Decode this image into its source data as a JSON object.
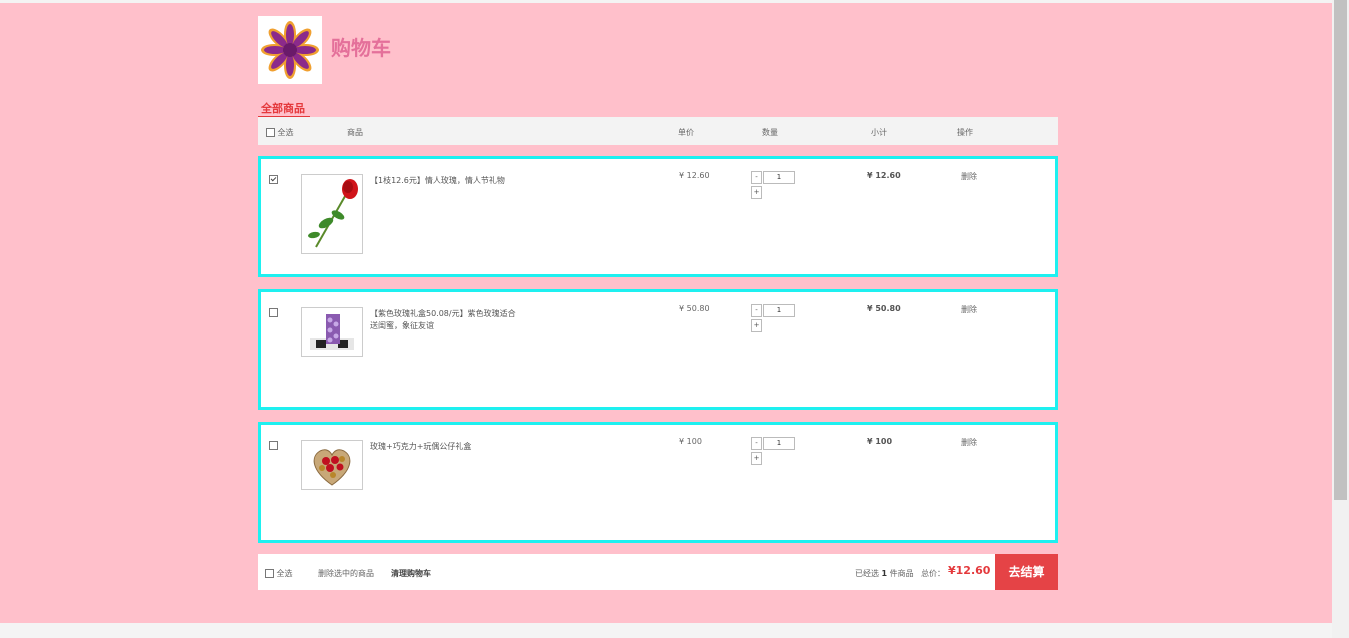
{
  "header": {
    "title": "购物车",
    "tab_all": "全部商品"
  },
  "table_header": {
    "select_all": "全选",
    "product": "商品",
    "unit_price": "单价",
    "quantity": "数量",
    "subtotal": "小计",
    "action": "操作"
  },
  "items": [
    {
      "checked": true,
      "name": "【1枝12.6元】情人玫瑰，情人节礼物",
      "price": "¥ 12.60",
      "minus": "-",
      "qty": "1",
      "plus": "+",
      "subtotal": "¥ 12.60",
      "delete": "删除"
    },
    {
      "checked": false,
      "name": "【紫色玫瑰礼盒50.08/元】紫色玫瑰适合送闺蜜，象征友谊",
      "price": "¥ 50.80",
      "minus": "-",
      "qty": "1",
      "plus": "+",
      "subtotal": "¥ 50.80",
      "delete": "删除"
    },
    {
      "checked": false,
      "name": "玫瑰+巧克力+玩偶公仔礼盒",
      "price": "¥ 100",
      "minus": "-",
      "qty": "1",
      "plus": "+",
      "subtotal": "¥ 100",
      "delete": "删除"
    }
  ],
  "footer": {
    "select_all": "全选",
    "delete_selected": "删除选中的商品",
    "clear_cart": "清理购物车",
    "selected_prefix": "已经选",
    "selected_count": "1",
    "selected_suffix": "件商品",
    "total_label": "总价：",
    "total_value": "¥12.60",
    "checkout": "去结算"
  },
  "colors": {
    "page_bg": "#ffc0cb",
    "item_border": "#1ef0f0",
    "accent_red": "#e4393c",
    "checkout_bg": "#e54346",
    "title_pink": "#e4709a"
  }
}
